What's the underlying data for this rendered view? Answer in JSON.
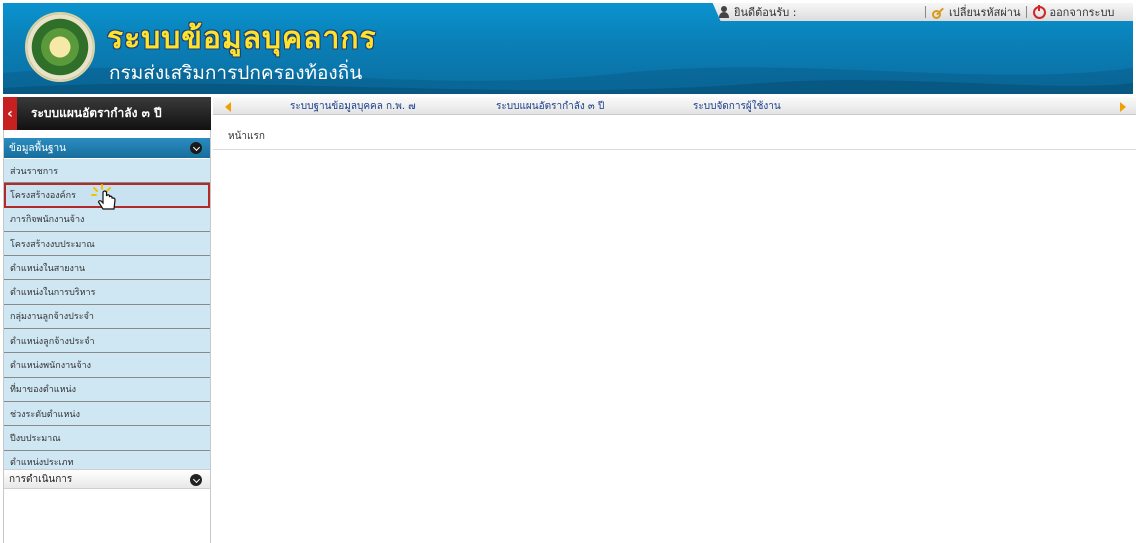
{
  "header": {
    "title": "ระบบข้อมูลบุคลากร",
    "subtitle": "กรมส่งเสริมการปกครองท้องถิ่น",
    "welcome": "ยินดีต้อนรับ :",
    "change_password": "เปลี่ยนรหัสผ่าน",
    "logout": "ออกจากระบบ"
  },
  "sidebar": {
    "title": "ระบบแผนอัตรากำลัง ๓ ปี",
    "section_basic": "ข้อมูลพื้นฐาน",
    "items": [
      {
        "label": "ส่วนราชการ"
      },
      {
        "label": "โครงสร้างองค์กร"
      },
      {
        "label": "ภารกิจพนักงานจ้าง"
      },
      {
        "label": "โครงสร้างงบประมาณ"
      },
      {
        "label": "ตำแหน่งในสายงาน"
      },
      {
        "label": "ตำแหน่งในการบริหาร"
      },
      {
        "label": "กลุ่มงานลูกจ้างประจำ"
      },
      {
        "label": "ตำแหน่งลูกจ้างประจำ"
      },
      {
        "label": "ตำแหน่งพนักงานจ้าง"
      },
      {
        "label": "ที่มาของตำแหน่ง"
      },
      {
        "label": "ช่วงระดับตำแหน่ง"
      },
      {
        "label": "ปีงบประมาณ"
      },
      {
        "label": "ตำแหน่งประเภท"
      }
    ],
    "section_ops": "การดำเนินการ"
  },
  "tabs": [
    {
      "label": "ระบบฐานข้อมูลบุคคล ก.พ. ๗"
    },
    {
      "label": "ระบบแผนอัตรากำลัง ๓ ปี"
    },
    {
      "label": "ระบบจัดการผู้ใช้งาน"
    }
  ],
  "breadcrumb": "หน้าแรก",
  "colors": {
    "header_blue": "#0a7fb6",
    "title_yellow": "#ffe22a",
    "menu_bg": "#cfe6f3",
    "section_blue": "#176e9c",
    "active_outline": "#b32a2a",
    "tab_text": "#1c3e8c"
  },
  "icons": [
    "user-icon",
    "key-icon",
    "power-icon",
    "back-arrow-icon",
    "chevron-down-icon",
    "arrow-left-icon",
    "arrow-right-icon",
    "hand-cursor-icon",
    "logo"
  ]
}
